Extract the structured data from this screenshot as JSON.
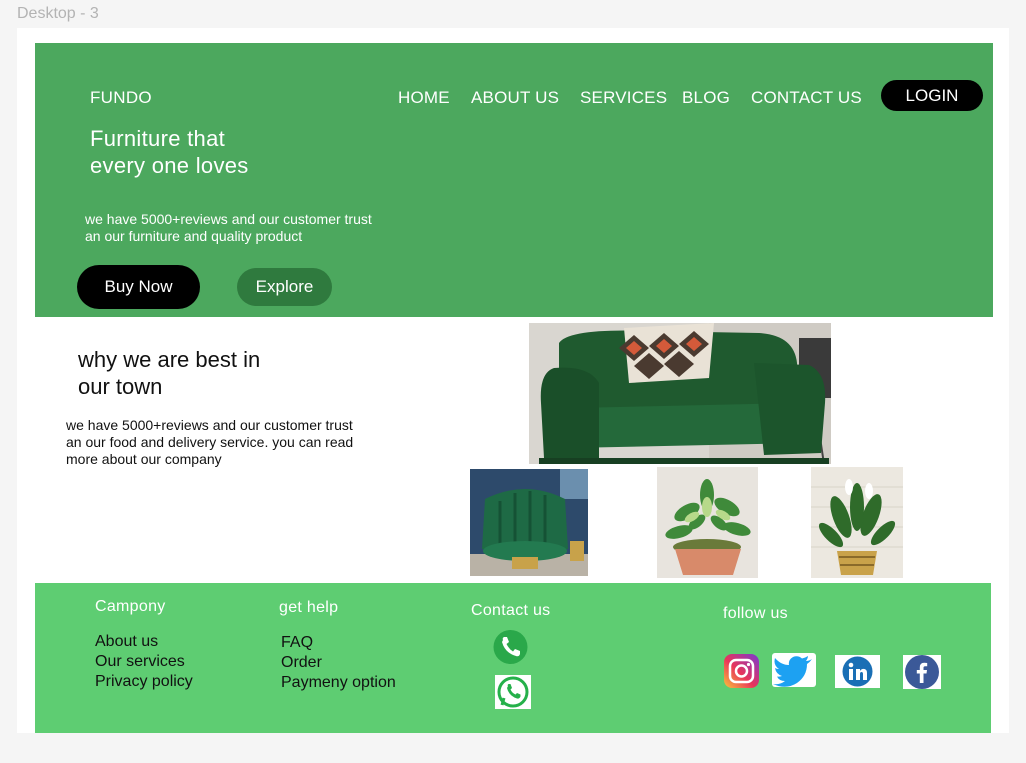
{
  "canvas": {
    "frame_label": "Desktop - 3"
  },
  "hero": {
    "brand": "FUNDO",
    "nav": [
      "HOME",
      "ABOUT US",
      "SERVICES",
      "BLOG",
      "CONTACT US"
    ],
    "login_label": "LOGIN",
    "headline": "Furniture that every one loves",
    "subline": "we have 5000+reviews and our customer trust an our furniture and quality product",
    "buy_label": "Buy Now",
    "explore_label": "Explore"
  },
  "why": {
    "title": "why we are best in our town",
    "text": "we have 5000+reviews and our customer trust an our food and delivery service. you can read more about our company"
  },
  "footer": {
    "company": {
      "heading": "Campony",
      "links": [
        "About us",
        "Our services",
        "Privacy policy"
      ]
    },
    "help": {
      "heading": "get help",
      "links": [
        "FAQ",
        "Order",
        "Paymeny option"
      ]
    },
    "contact": {
      "heading": "Contact us",
      "icons": [
        "phone-icon",
        "whatsapp-icon"
      ]
    },
    "follow": {
      "heading": "follow us",
      "icons": [
        "instagram-icon",
        "twitter-icon",
        "linkedin-icon",
        "facebook-icon"
      ]
    }
  },
  "colors": {
    "hero_green": "#4ca85e",
    "footer_green": "#5ecd72",
    "explore_green": "#2f7a3e",
    "button_black": "#000000"
  }
}
